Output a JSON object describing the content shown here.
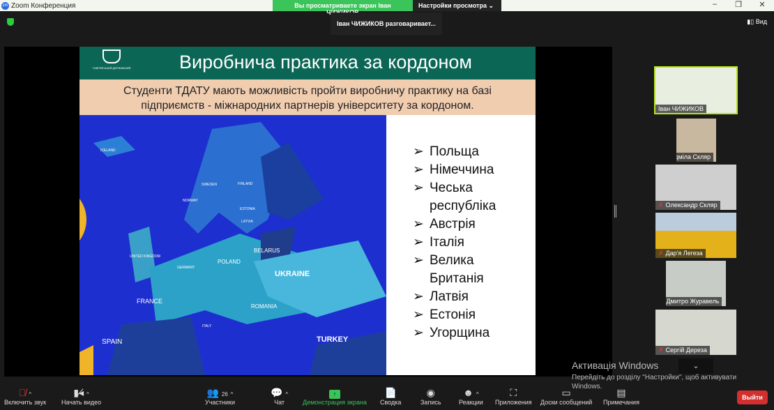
{
  "window": {
    "title": "Zoom Конференция",
    "banner": "Вы просматриваете экран Іван ЧИЖИКОВ",
    "view_options": "Настройки просмотра",
    "speaking": "Іван ЧИЖИКОВ разговаривает...",
    "view": "Вид"
  },
  "slide": {
    "title": "Виробнича практика за кордоном",
    "logo_text": "ТАВРІЙСЬКИЙ ДЕРЖАВНИЙ",
    "subtitle_1": "Студенти ТДАТУ мають можливість пройти виробничу практику на базі",
    "subtitle_2": "підприємств - міжнародних партнерів університету за кордоном.",
    "countries": [
      "Польща",
      "Німеччина",
      "Чеська республіка",
      "Австрія",
      "Італія",
      "Велика Британія",
      "Латвія",
      "Естонія",
      "Угорщина"
    ],
    "map_labels": [
      "ICELAND",
      "NORWAY",
      "SWEDEN",
      "FINLAND",
      "ESTONIA",
      "LATVIA",
      "BELARUS",
      "UKRAINE",
      "POLAND",
      "GERMANY",
      "UNITED KINGDOM",
      "FRANCE",
      "SPAIN",
      "ITALY",
      "ROMANIA",
      "TURKEY"
    ]
  },
  "participants": [
    {
      "name": "Іван ЧИЖИКОВ"
    },
    {
      "name": "Радміла Скляр"
    },
    {
      "name": "Олександр Скляр"
    },
    {
      "name": "Дар'я Легеза"
    },
    {
      "name": "Дмитро Журавель"
    },
    {
      "name": "Сергій Дереза"
    }
  ],
  "toolbar": {
    "unmute": "Включить звук",
    "video": "Начать видео",
    "participants": "Участники",
    "participants_count": "26",
    "chat": "Чат",
    "share": "Демонстрация экрана",
    "summary": "Сводка",
    "record": "Запись",
    "reactions": "Реакции",
    "apps": "Приложения",
    "whiteboards": "Доски сообщений",
    "notes": "Примечания",
    "leave": "Выйти"
  },
  "activation": {
    "title": "Активація Windows",
    "text": "Перейдіть до розділу \"Настройки\", щоб активувати Windows."
  }
}
